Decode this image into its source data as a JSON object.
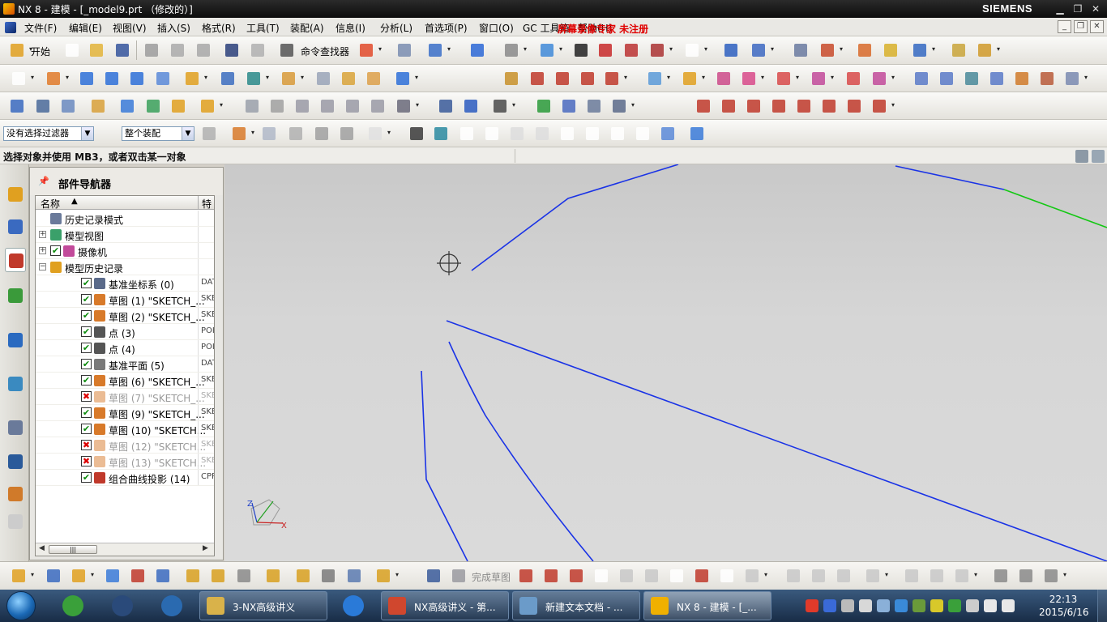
{
  "window": {
    "title": "NX 8 - 建模 - [_model9.prt （修改的）]",
    "brand": "SIEMENS"
  },
  "menu": {
    "items": [
      "文件(F)",
      "编辑(E)",
      "视图(V)",
      "插入(S)",
      "格式(R)",
      "工具(T)",
      "装配(A)",
      "信息(I)",
      "分析(L)",
      "首选项(P)",
      "窗口(O)",
      "GC 工具箱",
      "帮助(H)"
    ],
    "watermark": "屏幕录像专家  未注册"
  },
  "toolbar1": {
    "start_label": "开始",
    "command_finder_label": "命令查找器"
  },
  "selection_bar": {
    "filter_value": "没有选择过滤器",
    "scope_value": "整个装配"
  },
  "prompt": {
    "text": "选择对象并使用 MB3，或者双击某一对象"
  },
  "navigator": {
    "title": "部件导航器",
    "col_name": "名称",
    "col_feature": "特",
    "rows": [
      {
        "label": "历史记录模式",
        "feat": "",
        "check": "",
        "indent": 1,
        "expander": "",
        "icon": "clock"
      },
      {
        "label": "模型视图",
        "feat": "",
        "check": "",
        "indent": 1,
        "expander": "+",
        "icon": "view"
      },
      {
        "label": "摄像机",
        "feat": "",
        "check": "✔",
        "indent": 1,
        "expander": "+",
        "icon": "camera"
      },
      {
        "label": "模型历史记录",
        "feat": "",
        "check": "",
        "indent": 1,
        "expander": "−",
        "icon": "folder"
      },
      {
        "label": "基准坐标系 (0)",
        "feat": "DAT",
        "check": "✔",
        "indent": 2,
        "expander": "",
        "icon": "csys"
      },
      {
        "label": "草图 (1) \"SKETCH_...",
        "feat": "SKE",
        "check": "✔",
        "indent": 2,
        "expander": "",
        "icon": "sketch"
      },
      {
        "label": "草图 (2) \"SKETCH_...",
        "feat": "SKE",
        "check": "✔",
        "indent": 2,
        "expander": "",
        "icon": "sketch"
      },
      {
        "label": "点 (3)",
        "feat": "POI",
        "check": "✔",
        "indent": 2,
        "expander": "",
        "icon": "point"
      },
      {
        "label": "点 (4)",
        "feat": "POI",
        "check": "✔",
        "indent": 2,
        "expander": "",
        "icon": "point"
      },
      {
        "label": "基准平面 (5)",
        "feat": "DAT",
        "check": "✔",
        "indent": 2,
        "expander": "",
        "icon": "plane"
      },
      {
        "label": "草图 (6) \"SKETCH_...",
        "feat": "SKE",
        "check": "✔",
        "indent": 2,
        "expander": "",
        "icon": "sketch"
      },
      {
        "label": "草图 (7) \"SKETCH_...",
        "feat": "SKE",
        "check": "✖",
        "indent": 2,
        "expander": "",
        "icon": "sketch",
        "suppressed": true
      },
      {
        "label": "草图 (9) \"SKETCH_...",
        "feat": "SKE",
        "check": "✔",
        "indent": 2,
        "expander": "",
        "icon": "sketch"
      },
      {
        "label": "草图 (10) \"SKETCH...",
        "feat": "SKE",
        "check": "✔",
        "indent": 2,
        "expander": "",
        "icon": "sketch"
      },
      {
        "label": "草图 (12) \"SKETCH...",
        "feat": "SKE",
        "check": "✖",
        "indent": 2,
        "expander": "",
        "icon": "sketch",
        "suppressed": true
      },
      {
        "label": "草图 (13) \"SKETCH...",
        "feat": "SKE",
        "check": "✖",
        "indent": 2,
        "expander": "",
        "icon": "sketch",
        "suppressed": true
      },
      {
        "label": "组合曲线投影 (14)",
        "feat": "CPR",
        "check": "✔",
        "indent": 2,
        "expander": "",
        "icon": "project"
      }
    ]
  },
  "viewport": {
    "triad_z": "Z",
    "triad_x": "X",
    "curve_color": "#1a33e6",
    "highlight_color": "#14c814"
  },
  "bottom_toolbar": {
    "finish_sketch_label": "完成草图"
  },
  "taskbar": {
    "items": [
      {
        "label": "3-NX高级讲义",
        "color": "#d9b24a"
      },
      {
        "label": "NX高级讲义 - 第...",
        "color": "#d0472e"
      },
      {
        "label": "新建文本文档 - ...",
        "color": "#6b9bc9"
      },
      {
        "label": "NX 8 - 建模 - [_...",
        "color": "#f0b000"
      }
    ],
    "time": "22:13",
    "date": "2015/6/16"
  }
}
